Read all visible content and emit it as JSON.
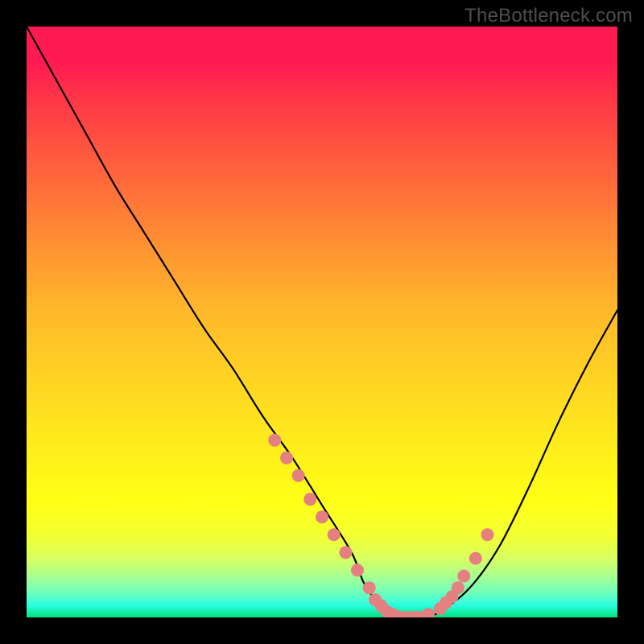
{
  "watermark": "TheBottleneck.com",
  "chart_data": {
    "type": "line",
    "title": "",
    "xlabel": "",
    "ylabel": "",
    "xlim": [
      0,
      100
    ],
    "ylim": [
      0,
      100
    ],
    "series": [
      {
        "name": "bottleneck-curve",
        "x": [
          0,
          5,
          10,
          15,
          20,
          25,
          30,
          35,
          40,
          45,
          50,
          55,
          57,
          59,
          61,
          63,
          67,
          70,
          75,
          80,
          85,
          90,
          95,
          100
        ],
        "y": [
          100,
          91,
          82,
          73,
          65,
          57,
          49,
          42,
          34,
          27,
          19,
          11,
          6,
          3,
          1,
          0,
          0,
          1,
          5,
          12,
          22,
          33,
          43,
          52
        ]
      }
    ],
    "markers": {
      "name": "highlight-dots",
      "color": "#e58080",
      "x": [
        42,
        44,
        46,
        48,
        50,
        52,
        54,
        56,
        58,
        59,
        60,
        61,
        62,
        63,
        64,
        65,
        66,
        67,
        68,
        70,
        71,
        72,
        73,
        74,
        76,
        78
      ],
      "y": [
        30,
        27,
        24,
        20,
        17,
        14,
        11,
        8,
        5,
        3,
        2,
        1,
        0.5,
        0,
        0,
        0,
        0,
        0,
        0.5,
        1.5,
        2.5,
        3.5,
        5,
        7,
        10,
        14
      ]
    },
    "background_gradient": {
      "stops": [
        {
          "pos": 0.0,
          "color": "#ff1a52"
        },
        {
          "pos": 0.35,
          "color": "#ff8a34"
        },
        {
          "pos": 0.65,
          "color": "#ffe020"
        },
        {
          "pos": 0.86,
          "color": "#f3ff30"
        },
        {
          "pos": 1.0,
          "color": "#00e078"
        }
      ]
    }
  }
}
